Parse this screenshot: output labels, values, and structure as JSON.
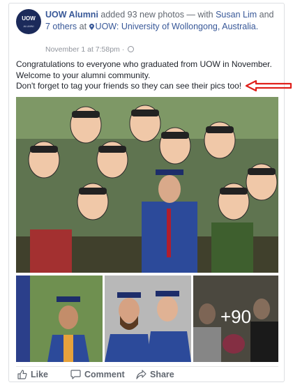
{
  "post": {
    "page_name": "UOW Alumni",
    "added_text": " added 93 new photos — with ",
    "tagged_person": "Susan Lim",
    "and_text": " and ",
    "others": "7 others",
    "at_text": " at ",
    "location": "UOW: University of Wollongong, Australia.",
    "timestamp": "November 1 at 7:58pm · ",
    "avatar_logo": "UOW",
    "avatar_sub": "ALUMNI",
    "caption": [
      "Congratulations to everyone who graduated from UOW in November.",
      "Welcome to your alumni community.",
      "Don't forget to tag your friends so they can see their pics too!"
    ],
    "more_photos": "+90"
  },
  "actions": {
    "like": "Like",
    "comment": "Comment",
    "share": "Share"
  },
  "colors": {
    "link": "#385898",
    "annotation_arrow": "#e0201b",
    "avatar_bg": "#1b2a5a"
  }
}
